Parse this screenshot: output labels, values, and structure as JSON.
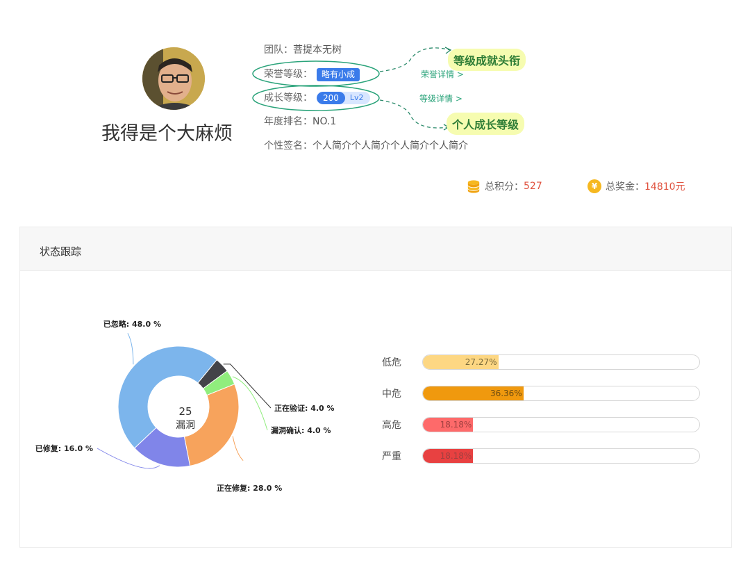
{
  "profile": {
    "username": "我得是个大麻烦",
    "team_label": "团队：",
    "team_value": "菩提本无树",
    "honor_label": "荣誉等级：",
    "honor_badge": "略有小成",
    "growth_label": "成长等级：",
    "growth_points": "200",
    "growth_level": "Lv2",
    "rank_label": "年度排名：",
    "rank_value": "NO.1",
    "signature_label": "个性签名：",
    "signature_value": "个人简介个人简介个人简介个人简介",
    "honor_detail_link": "荣誉详情 >",
    "growth_detail_link": "等级详情 >",
    "callout_title": "等级成就头衔",
    "callout_growth": "个人成长等级"
  },
  "stats": {
    "points_label": "总积分：",
    "points_value": "527",
    "bonus_label": "总奖金：",
    "bonus_value": "14810元",
    "points_icon": "coin-stack-icon",
    "bonus_icon": "yen-coin-icon"
  },
  "panel": {
    "title": "状态跟踪"
  },
  "chart_data": [
    {
      "type": "pie",
      "center_value": "25",
      "center_label": "漏洞",
      "slices": [
        {
          "label": "已忽略: 48.0 %",
          "value": 48.0,
          "color": "#7cb5ec"
        },
        {
          "label": "正在验证: 4.0 %",
          "value": 4.0,
          "color": "#434348"
        },
        {
          "label": "漏洞确认: 4.0 %",
          "value": 4.0,
          "color": "#90ed7d"
        },
        {
          "label": "正在修复: 28.0 %",
          "value": 28.0,
          "color": "#f7a35c"
        },
        {
          "label": "已修复: 16.0 %",
          "value": 16.0,
          "color": "#8085e9"
        }
      ]
    },
    {
      "type": "bar",
      "orientation": "horizontal",
      "categories": [
        "低危",
        "中危",
        "高危",
        "严重"
      ],
      "values": [
        27.27,
        36.36,
        18.18,
        18.18
      ],
      "value_labels": [
        "27.27%",
        "36.36%",
        "18.18%",
        "18.18%"
      ],
      "colors": [
        "#fdd783",
        "#f0990e",
        "#fe6a6a",
        "#e84141"
      ],
      "xlim": [
        0,
        100
      ]
    }
  ]
}
